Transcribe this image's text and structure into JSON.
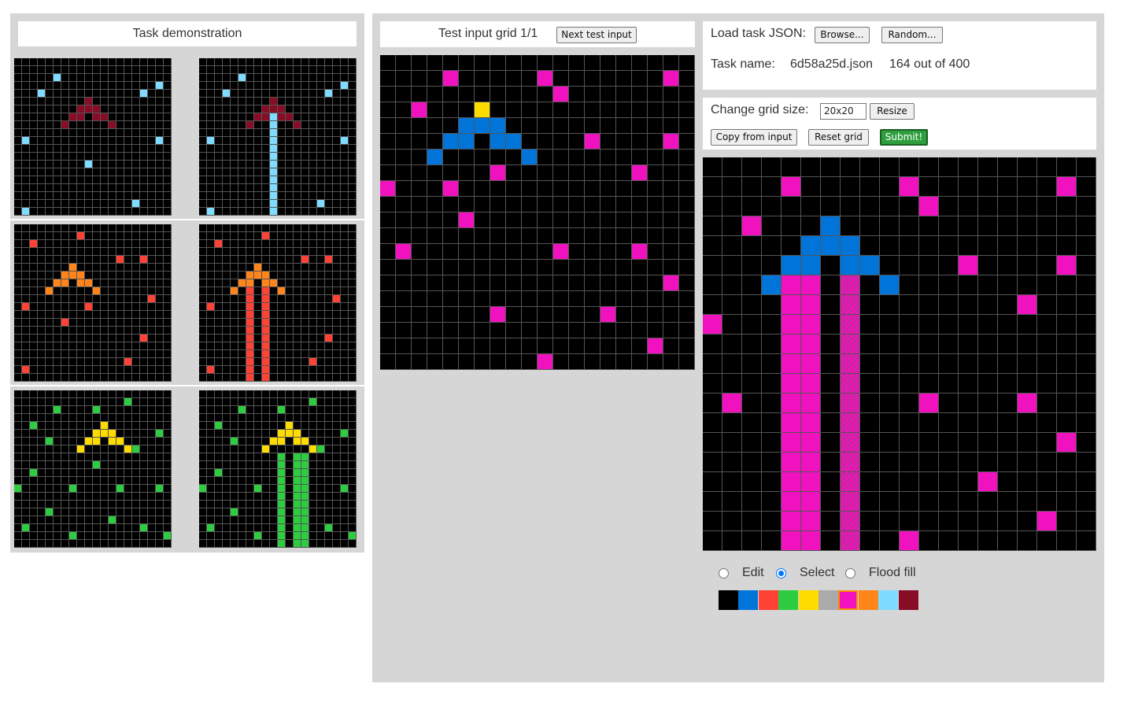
{
  "palette": [
    "#000000",
    "#0074d9",
    "#ff4136",
    "#2ecc40",
    "#ffdc00",
    "#aaaaaa",
    "#f012be",
    "#ff851b",
    "#7fdbff",
    "#870c25"
  ],
  "demo": {
    "title": "Task demonstration",
    "pairs": [
      {
        "input": {
          "w": 20,
          "h": 20,
          "cells": [
            [
              2,
              5,
              8
            ],
            [
              3,
              18,
              8
            ],
            [
              4,
              3,
              8
            ],
            [
              4,
              16,
              8
            ],
            [
              5,
              9,
              9
            ],
            [
              6,
              8,
              9
            ],
            [
              6,
              9,
              9
            ],
            [
              6,
              10,
              9
            ],
            [
              7,
              7,
              9
            ],
            [
              7,
              8,
              9
            ],
            [
              7,
              10,
              9
            ],
            [
              7,
              11,
              9
            ],
            [
              8,
              6,
              9
            ],
            [
              8,
              12,
              9
            ],
            [
              10,
              1,
              8
            ],
            [
              10,
              18,
              8
            ],
            [
              13,
              9,
              8
            ],
            [
              18,
              15,
              8
            ],
            [
              19,
              1,
              8
            ]
          ]
        },
        "output": {
          "w": 20,
          "h": 20,
          "cells": [
            [
              2,
              5,
              8
            ],
            [
              3,
              18,
              8
            ],
            [
              4,
              3,
              8
            ],
            [
              4,
              16,
              8
            ],
            [
              5,
              9,
              9
            ],
            [
              6,
              8,
              9
            ],
            [
              6,
              9,
              9
            ],
            [
              6,
              10,
              9
            ],
            [
              7,
              7,
              9
            ],
            [
              7,
              8,
              9
            ],
            [
              7,
              10,
              9
            ],
            [
              7,
              11,
              9
            ],
            [
              8,
              6,
              9
            ],
            [
              8,
              12,
              9
            ],
            [
              10,
              1,
              8
            ],
            [
              10,
              18,
              8
            ],
            [
              18,
              15,
              8
            ],
            [
              19,
              1,
              8
            ]
          ],
          "cols": [
            [
              9,
              7,
              19,
              8
            ]
          ]
        }
      },
      {
        "input": {
          "w": 20,
          "h": 20,
          "cells": [
            [
              1,
              8,
              2
            ],
            [
              2,
              2,
              2
            ],
            [
              4,
              13,
              2
            ],
            [
              4,
              16,
              2
            ],
            [
              5,
              7,
              7
            ],
            [
              6,
              6,
              7
            ],
            [
              6,
              7,
              7
            ],
            [
              6,
              8,
              7
            ],
            [
              7,
              5,
              7
            ],
            [
              7,
              6,
              7
            ],
            [
              7,
              8,
              7
            ],
            [
              7,
              9,
              7
            ],
            [
              8,
              4,
              7
            ],
            [
              8,
              10,
              7
            ],
            [
              9,
              17,
              2
            ],
            [
              10,
              1,
              2
            ],
            [
              10,
              9,
              2
            ],
            [
              12,
              6,
              2
            ],
            [
              14,
              16,
              2
            ],
            [
              17,
              14,
              2
            ],
            [
              18,
              1,
              2
            ]
          ]
        },
        "output": {
          "w": 20,
          "h": 20,
          "cells": [
            [
              1,
              8,
              2
            ],
            [
              2,
              2,
              2
            ],
            [
              4,
              13,
              2
            ],
            [
              4,
              16,
              2
            ],
            [
              5,
              7,
              7
            ],
            [
              6,
              6,
              7
            ],
            [
              6,
              7,
              7
            ],
            [
              6,
              8,
              7
            ],
            [
              7,
              5,
              7
            ],
            [
              7,
              6,
              7
            ],
            [
              7,
              8,
              7
            ],
            [
              7,
              9,
              7
            ],
            [
              8,
              4,
              7
            ],
            [
              8,
              10,
              7
            ],
            [
              9,
              17,
              2
            ],
            [
              10,
              1,
              2
            ],
            [
              14,
              16,
              2
            ],
            [
              17,
              14,
              2
            ],
            [
              18,
              1,
              2
            ]
          ],
          "cols": [
            [
              6,
              8,
              19,
              2
            ],
            [
              8,
              8,
              19,
              2
            ]
          ]
        }
      },
      {
        "input": {
          "w": 20,
          "h": 20,
          "cells": [
            [
              1,
              14,
              3
            ],
            [
              2,
              5,
              3
            ],
            [
              2,
              10,
              3
            ],
            [
              4,
              2,
              3
            ],
            [
              4,
              11,
              4
            ],
            [
              5,
              10,
              4
            ],
            [
              5,
              11,
              4
            ],
            [
              5,
              12,
              4
            ],
            [
              6,
              9,
              4
            ],
            [
              6,
              10,
              4
            ],
            [
              6,
              12,
              4
            ],
            [
              6,
              13,
              4
            ],
            [
              7,
              8,
              4
            ],
            [
              7,
              14,
              4
            ],
            [
              5,
              18,
              3
            ],
            [
              6,
              4,
              3
            ],
            [
              7,
              15,
              3
            ],
            [
              9,
              10,
              3
            ],
            [
              10,
              2,
              3
            ],
            [
              12,
              0,
              3
            ],
            [
              12,
              7,
              3
            ],
            [
              12,
              13,
              3
            ],
            [
              12,
              18,
              3
            ],
            [
              15,
              4,
              3
            ],
            [
              16,
              12,
              3
            ],
            [
              17,
              1,
              3
            ],
            [
              17,
              16,
              3
            ],
            [
              18,
              7,
              3
            ],
            [
              18,
              19,
              3
            ]
          ]
        },
        "output": {
          "w": 20,
          "h": 20,
          "cells": [
            [
              1,
              14,
              3
            ],
            [
              2,
              5,
              3
            ],
            [
              2,
              10,
              3
            ],
            [
              4,
              2,
              3
            ],
            [
              4,
              11,
              4
            ],
            [
              5,
              10,
              4
            ],
            [
              5,
              11,
              4
            ],
            [
              5,
              12,
              4
            ],
            [
              6,
              9,
              4
            ],
            [
              6,
              10,
              4
            ],
            [
              6,
              12,
              4
            ],
            [
              6,
              13,
              4
            ],
            [
              7,
              8,
              4
            ],
            [
              7,
              14,
              4
            ],
            [
              5,
              18,
              3
            ],
            [
              6,
              4,
              3
            ],
            [
              7,
              15,
              3
            ],
            [
              10,
              2,
              3
            ],
            [
              12,
              0,
              3
            ],
            [
              12,
              7,
              3
            ],
            [
              12,
              13,
              3
            ],
            [
              12,
              18,
              3
            ],
            [
              15,
              4,
              3
            ],
            [
              16,
              12,
              3
            ],
            [
              17,
              1,
              3
            ],
            [
              17,
              16,
              3
            ],
            [
              18,
              7,
              3
            ],
            [
              18,
              19,
              3
            ]
          ],
          "cols": [
            [
              10,
              8,
              19,
              3
            ],
            [
              12,
              8,
              19,
              3
            ],
            [
              13,
              8,
              19,
              3
            ]
          ]
        }
      }
    ]
  },
  "test": {
    "header": "Test input grid 1/1",
    "next_button": "Next test input",
    "grid": {
      "w": 20,
      "h": 20,
      "cells": [
        [
          1,
          4,
          6
        ],
        [
          1,
          10,
          6
        ],
        [
          1,
          18,
          6
        ],
        [
          2,
          11,
          6
        ],
        [
          3,
          2,
          6
        ],
        [
          3,
          6,
          4
        ],
        [
          4,
          5,
          1
        ],
        [
          4,
          6,
          1
        ],
        [
          4,
          7,
          1
        ],
        [
          5,
          4,
          1
        ],
        [
          5,
          5,
          1
        ],
        [
          5,
          7,
          1
        ],
        [
          5,
          8,
          1
        ],
        [
          6,
          3,
          1
        ],
        [
          6,
          9,
          1
        ],
        [
          5,
          13,
          6
        ],
        [
          5,
          18,
          6
        ],
        [
          7,
          7,
          6
        ],
        [
          7,
          16,
          6
        ],
        [
          8,
          0,
          6
        ],
        [
          8,
          4,
          6
        ],
        [
          10,
          5,
          6
        ],
        [
          12,
          1,
          6
        ],
        [
          12,
          11,
          6
        ],
        [
          12,
          16,
          6
        ],
        [
          14,
          18,
          6
        ],
        [
          16,
          7,
          6
        ],
        [
          16,
          14,
          6
        ],
        [
          18,
          17,
          6
        ],
        [
          19,
          10,
          6
        ]
      ]
    }
  },
  "controls": {
    "load_label": "Load task JSON:",
    "browse": "Browse...",
    "random": "Random...",
    "task_name_label": "Task name:",
    "task_name": "6d58a25d.json",
    "progress": "164 out of 400",
    "size_label": "Change grid size:",
    "size_value": "20x20",
    "resize": "Resize",
    "copy": "Copy from input",
    "reset": "Reset grid",
    "submit": "Submit!",
    "modes": [
      "Edit",
      "Select",
      "Flood fill"
    ],
    "selected_mode": "Select",
    "selected_color_index": 6
  },
  "output": {
    "w": 20,
    "h": 20,
    "cells": [
      [
        1,
        4,
        6
      ],
      [
        1,
        10,
        6
      ],
      [
        1,
        18,
        6
      ],
      [
        2,
        11,
        6
      ],
      [
        3,
        2,
        6
      ],
      [
        3,
        6,
        1
      ],
      [
        4,
        5,
        1
      ],
      [
        4,
        6,
        1
      ],
      [
        4,
        7,
        1
      ],
      [
        5,
        4,
        1
      ],
      [
        5,
        5,
        1
      ],
      [
        5,
        7,
        1
      ],
      [
        5,
        8,
        1
      ],
      [
        6,
        3,
        1
      ],
      [
        6,
        9,
        1
      ],
      [
        5,
        13,
        6
      ],
      [
        5,
        18,
        6
      ],
      [
        7,
        16,
        6
      ],
      [
        8,
        0,
        6
      ],
      [
        12,
        1,
        6
      ],
      [
        12,
        11,
        6
      ],
      [
        12,
        16,
        6
      ],
      [
        14,
        18,
        6
      ],
      [
        16,
        14,
        6
      ],
      [
        18,
        17,
        6
      ],
      [
        19,
        10,
        6
      ]
    ],
    "cols": [
      [
        4,
        6,
        19,
        6
      ],
      [
        5,
        6,
        19,
        6
      ]
    ],
    "hatched_col": [
      7,
      6,
      19
    ]
  }
}
